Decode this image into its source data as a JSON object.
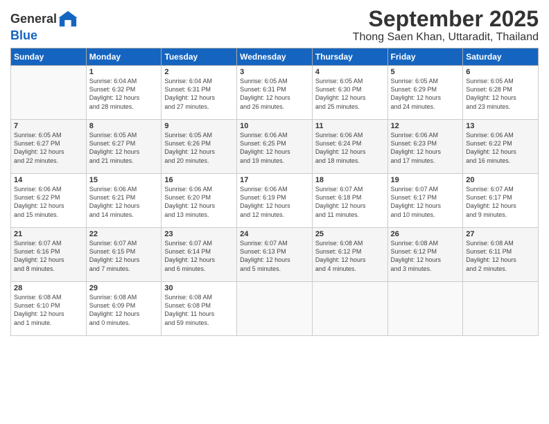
{
  "logo": {
    "text_general": "General",
    "text_blue": "Blue"
  },
  "header": {
    "month": "September 2025",
    "location": "Thong Saen Khan, Uttaradit, Thailand"
  },
  "days_of_week": [
    "Sunday",
    "Monday",
    "Tuesday",
    "Wednesday",
    "Thursday",
    "Friday",
    "Saturday"
  ],
  "weeks": [
    [
      {
        "day": "",
        "info": ""
      },
      {
        "day": "1",
        "info": "Sunrise: 6:04 AM\nSunset: 6:32 PM\nDaylight: 12 hours\nand 28 minutes."
      },
      {
        "day": "2",
        "info": "Sunrise: 6:04 AM\nSunset: 6:31 PM\nDaylight: 12 hours\nand 27 minutes."
      },
      {
        "day": "3",
        "info": "Sunrise: 6:05 AM\nSunset: 6:31 PM\nDaylight: 12 hours\nand 26 minutes."
      },
      {
        "day": "4",
        "info": "Sunrise: 6:05 AM\nSunset: 6:30 PM\nDaylight: 12 hours\nand 25 minutes."
      },
      {
        "day": "5",
        "info": "Sunrise: 6:05 AM\nSunset: 6:29 PM\nDaylight: 12 hours\nand 24 minutes."
      },
      {
        "day": "6",
        "info": "Sunrise: 6:05 AM\nSunset: 6:28 PM\nDaylight: 12 hours\nand 23 minutes."
      }
    ],
    [
      {
        "day": "7",
        "info": "Sunrise: 6:05 AM\nSunset: 6:27 PM\nDaylight: 12 hours\nand 22 minutes."
      },
      {
        "day": "8",
        "info": "Sunrise: 6:05 AM\nSunset: 6:27 PM\nDaylight: 12 hours\nand 21 minutes."
      },
      {
        "day": "9",
        "info": "Sunrise: 6:05 AM\nSunset: 6:26 PM\nDaylight: 12 hours\nand 20 minutes."
      },
      {
        "day": "10",
        "info": "Sunrise: 6:06 AM\nSunset: 6:25 PM\nDaylight: 12 hours\nand 19 minutes."
      },
      {
        "day": "11",
        "info": "Sunrise: 6:06 AM\nSunset: 6:24 PM\nDaylight: 12 hours\nand 18 minutes."
      },
      {
        "day": "12",
        "info": "Sunrise: 6:06 AM\nSunset: 6:23 PM\nDaylight: 12 hours\nand 17 minutes."
      },
      {
        "day": "13",
        "info": "Sunrise: 6:06 AM\nSunset: 6:22 PM\nDaylight: 12 hours\nand 16 minutes."
      }
    ],
    [
      {
        "day": "14",
        "info": "Sunrise: 6:06 AM\nSunset: 6:22 PM\nDaylight: 12 hours\nand 15 minutes."
      },
      {
        "day": "15",
        "info": "Sunrise: 6:06 AM\nSunset: 6:21 PM\nDaylight: 12 hours\nand 14 minutes."
      },
      {
        "day": "16",
        "info": "Sunrise: 6:06 AM\nSunset: 6:20 PM\nDaylight: 12 hours\nand 13 minutes."
      },
      {
        "day": "17",
        "info": "Sunrise: 6:06 AM\nSunset: 6:19 PM\nDaylight: 12 hours\nand 12 minutes."
      },
      {
        "day": "18",
        "info": "Sunrise: 6:07 AM\nSunset: 6:18 PM\nDaylight: 12 hours\nand 11 minutes."
      },
      {
        "day": "19",
        "info": "Sunrise: 6:07 AM\nSunset: 6:17 PM\nDaylight: 12 hours\nand 10 minutes."
      },
      {
        "day": "20",
        "info": "Sunrise: 6:07 AM\nSunset: 6:17 PM\nDaylight: 12 hours\nand 9 minutes."
      }
    ],
    [
      {
        "day": "21",
        "info": "Sunrise: 6:07 AM\nSunset: 6:16 PM\nDaylight: 12 hours\nand 8 minutes."
      },
      {
        "day": "22",
        "info": "Sunrise: 6:07 AM\nSunset: 6:15 PM\nDaylight: 12 hours\nand 7 minutes."
      },
      {
        "day": "23",
        "info": "Sunrise: 6:07 AM\nSunset: 6:14 PM\nDaylight: 12 hours\nand 6 minutes."
      },
      {
        "day": "24",
        "info": "Sunrise: 6:07 AM\nSunset: 6:13 PM\nDaylight: 12 hours\nand 5 minutes."
      },
      {
        "day": "25",
        "info": "Sunrise: 6:08 AM\nSunset: 6:12 PM\nDaylight: 12 hours\nand 4 minutes."
      },
      {
        "day": "26",
        "info": "Sunrise: 6:08 AM\nSunset: 6:12 PM\nDaylight: 12 hours\nand 3 minutes."
      },
      {
        "day": "27",
        "info": "Sunrise: 6:08 AM\nSunset: 6:11 PM\nDaylight: 12 hours\nand 2 minutes."
      }
    ],
    [
      {
        "day": "28",
        "info": "Sunrise: 6:08 AM\nSunset: 6:10 PM\nDaylight: 12 hours\nand 1 minute."
      },
      {
        "day": "29",
        "info": "Sunrise: 6:08 AM\nSunset: 6:09 PM\nDaylight: 12 hours\nand 0 minutes."
      },
      {
        "day": "30",
        "info": "Sunrise: 6:08 AM\nSunset: 6:08 PM\nDaylight: 11 hours\nand 59 minutes."
      },
      {
        "day": "",
        "info": ""
      },
      {
        "day": "",
        "info": ""
      },
      {
        "day": "",
        "info": ""
      },
      {
        "day": "",
        "info": ""
      }
    ]
  ]
}
